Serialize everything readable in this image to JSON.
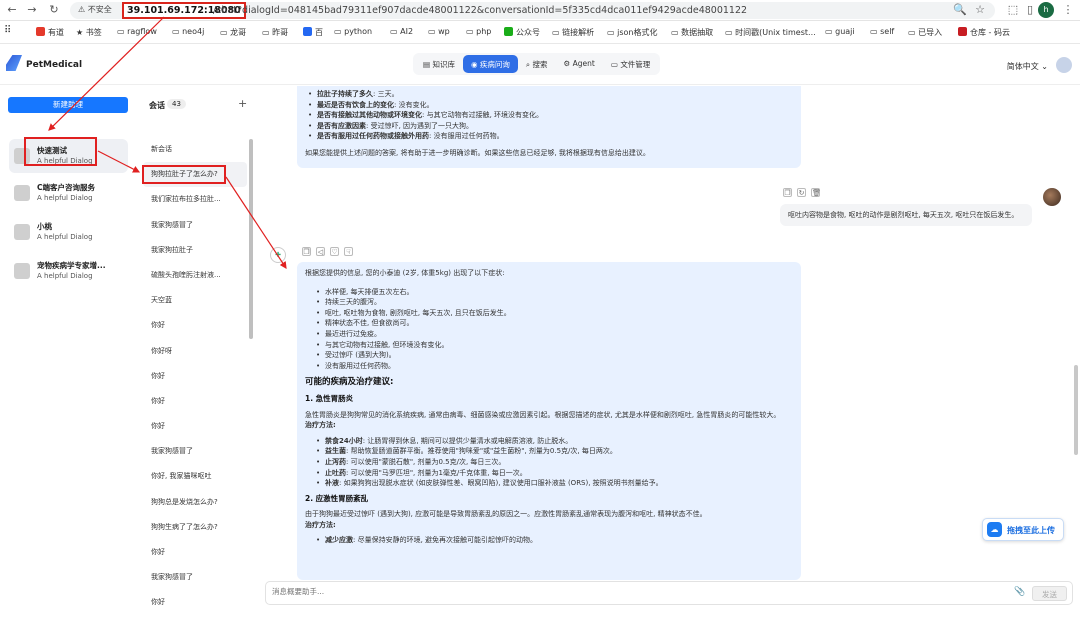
{
  "browser": {
    "insecure_label": "不安全",
    "url_host": "39.101.69.172:18080",
    "url_rest": "/chat?dialogId=048145bad79311ef907dacde48001122&conversationId=5f335cd4dca011ef9429acde48001122",
    "profile_initial": "h",
    "bookmarks": [
      "有道",
      "书签",
      "ragflow",
      "neo4j",
      "龙哥",
      "昨哥",
      "百",
      "python",
      "AI2",
      "wp",
      "php",
      "公众号",
      "链接解析",
      "json格式化",
      "数据抽取",
      "时间戳(Unix timest...",
      "guaji",
      "self",
      "已导入",
      "仓库 - 码云"
    ]
  },
  "app": {
    "brand": "PetMedical",
    "nav": [
      "知识库",
      "疾病问询",
      "搜索",
      "Agent",
      "文件管理"
    ],
    "active_nav": 1,
    "language": "简体中文"
  },
  "left": {
    "new_button": "新建助理",
    "assistants": [
      {
        "name": "快速测试",
        "desc": "A helpful Dialog"
      },
      {
        "name": "C端客户咨询服务",
        "desc": "A helpful Dialog"
      },
      {
        "name": "小桃",
        "desc": "A helpful Dialog"
      },
      {
        "name": "宠物疾病学专家增...",
        "desc": "A helpful Dialog"
      }
    ]
  },
  "conversations": {
    "title": "会话",
    "count": "43",
    "items": [
      "新会话",
      "狗狗拉肚子了怎么办?",
      "我们家拉布拉多拉肚...",
      "我家狗感冒了",
      "我家狗拉肚子",
      "硫酸头孢喹肟注射液...",
      "天空蓝",
      "你好",
      "你好呀",
      "你好",
      "你好",
      "你好",
      "我家狗感冒了",
      "你好, 我家猫咪呕吐",
      "狗狗总是发烧怎么办?",
      "狗狗生病了了怎么办?",
      "你好",
      "我家狗感冒了",
      "你好"
    ]
  },
  "chat": {
    "prev": {
      "items": [
        {
          "label": "拉肚子持续了多久",
          "text": "三天。"
        },
        {
          "label": "最近是否有饮食上的变化",
          "text": "没有变化。"
        },
        {
          "label": "是否有接触过其他动物或环境变化",
          "text": "与其它动物有过接触, 环境没有变化。"
        },
        {
          "label": "是否有应激因素",
          "text": "受过惊吓, 因为遇到了一只大狗。"
        },
        {
          "label": "是否有服用过任何药物或接触外用药",
          "text": "没有服用过任何药物。"
        }
      ],
      "footer": "如果您能提供上述问题的答案, 将有助于进一步明确诊断。如果这些信息已经足够, 我将根据现有信息给出建议。"
    },
    "user_msg": "呕吐内容物是食物, 呕吐的动作是剧烈呕吐, 每天五次, 呕吐只在饭后发生。",
    "reply": {
      "intro": "根据您提供的信息, 您的小泰迪 (2岁, 体重5kg) 出现了以下症状:",
      "symptoms": [
        "水样便, 每天排便五次左右。",
        "持续三天的腹泻。",
        "呕吐, 呕吐物为食物, 剧烈呕吐, 每天五次, 且只在饭后发生。",
        "精神状态不佳, 但食欲尚可。",
        "最近进行过免疫。",
        "与其它动物有过接触, 但环境没有变化。",
        "受过惊吓 (遇到大狗)。",
        "没有服用过任何药物。"
      ],
      "heading": "可能的疾病及治疗建议:",
      "d1_title": "1. 急性胃肠炎",
      "d1_desc": "急性胃肠炎是狗狗常见的消化系统疾病, 通常由病毒、细菌感染或应激因素引起。根据您描述的症状, 尤其是水样便和剧烈呕吐, 急性胃肠炎的可能性较大。",
      "treat_label": "治疗方法:",
      "d1_treat": [
        {
          "label": "禁食24小时",
          "text": "让肠胃得到休息, 期间可以提供少量清水或电解质溶液, 防止脱水。"
        },
        {
          "label": "益生菌",
          "text": "帮助恢复肠道菌群平衡。推荐使用\"狗咪爱\"或\"益生菌粉\", 剂量为0.5克/次, 每日两次。"
        },
        {
          "label": "止泻药",
          "text": "可以使用\"蒙脱石散\", 剂量为0.5克/次, 每日三次。"
        },
        {
          "label": "止吐药",
          "text": "可以使用\"马罗匹坦\", 剂量为1毫克/千克体重, 每日一次。"
        },
        {
          "label": "补液",
          "text": "如果狗狗出现脱水症状 (如皮肤弹性差、眼窝凹陷), 建议使用口服补液盐 (ORS), 按照说明书剂量给予。"
        }
      ],
      "d2_title": "2. 应激性胃肠紊乱",
      "d2_desc": "由于狗狗最近受过惊吓 (遇到大狗), 应激可能是导致胃肠紊乱的原因之一。应激性胃肠紊乱通常表现为腹泻和呕吐, 精神状态不佳。",
      "d2_treat": [
        {
          "label": "减少应激",
          "text": "尽量保持安静的环境, 避免再次接触可能引起惊吓的动物。"
        }
      ]
    },
    "upload_label": "拖拽至此上传",
    "input_placeholder": "消息概要助手...",
    "send_label": "发送"
  },
  "colors": {
    "primary": "#1677ff",
    "annotation_red": "#e02020",
    "ai_bubble": "#e8f1ff"
  }
}
